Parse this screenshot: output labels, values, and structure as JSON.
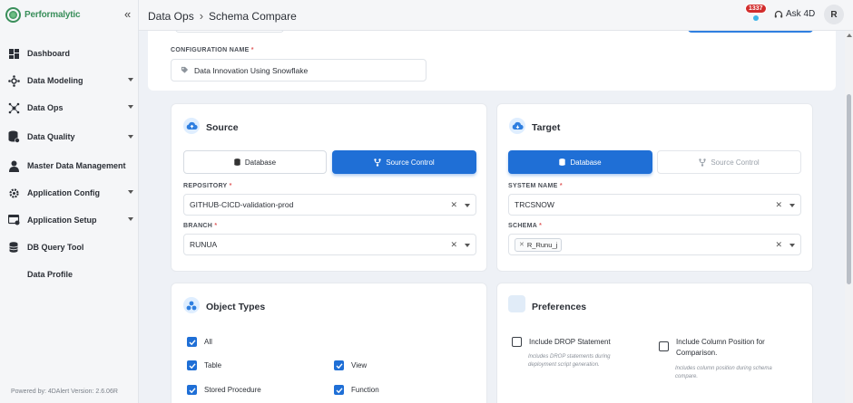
{
  "app": {
    "brand": "Performalytic",
    "collapse_icon": "«"
  },
  "sidebar": {
    "items": [
      {
        "label": "Dashboard",
        "icon": "dashboard-icon",
        "caret": false
      },
      {
        "label": "Data Modeling",
        "icon": "hub-icon",
        "caret": true
      },
      {
        "label": "Data Ops",
        "icon": "network-icon",
        "caret": true
      },
      {
        "label": "Data Quality",
        "icon": "database-check-icon",
        "caret": true
      },
      {
        "label": "Master Data Management",
        "icon": "person-icon",
        "caret": false
      },
      {
        "label": "Application Config",
        "icon": "gear-icon",
        "caret": true
      },
      {
        "label": "Application Setup",
        "icon": "setup-icon",
        "caret": true
      },
      {
        "label": "DB Query Tool",
        "icon": "database-icon",
        "caret": false
      },
      {
        "label": "Data Profile",
        "icon": "",
        "caret": false
      }
    ],
    "footer": "Powered by: 4DAlert   Version: 2.6.06R"
  },
  "header": {
    "crumb_parent": "Data Ops",
    "crumb_sep": "›",
    "crumb_current": "Schema Compare",
    "notification_count": "1337",
    "ask_label": "Ask 4D",
    "avatar_initial": "R"
  },
  "config": {
    "label": "CONFIGURATION NAME",
    "required_mark": "*",
    "value": "Data Innovation Using Snowflake"
  },
  "source": {
    "title": "Source",
    "tab_database": "Database",
    "tab_source_control": "Source Control",
    "repository_label": "REPOSITORY",
    "repository_value": "GITHUB-CICD-validation-prod",
    "branch_label": "BRANCH",
    "branch_value": "RUNUA"
  },
  "target": {
    "title": "Target",
    "tab_database": "Database",
    "tab_source_control": "Source Control",
    "system_label": "SYSTEM NAME",
    "system_value": "TRCSNOW",
    "schema_label": "SCHEMA",
    "schema_chip": "R_Runu_j"
  },
  "object_types": {
    "title": "Object Types",
    "items": [
      {
        "label": "All",
        "checked": true
      },
      {
        "label": "Table",
        "checked": true
      },
      {
        "label": "View",
        "checked": true
      },
      {
        "label": "Stored Procedure",
        "checked": true
      },
      {
        "label": "Function",
        "checked": true
      }
    ]
  },
  "preferences": {
    "title": "Preferences",
    "drop_label": "Include DROP Statement",
    "drop_desc_1": "Includes DROP statements during",
    "drop_desc_2": "deployment script generation.",
    "colpos_label_1": "Include Column Position for",
    "colpos_label_2": "Comparison.",
    "colpos_desc_1": "Includes column position during schema",
    "colpos_desc_2": "compare."
  },
  "colors": {
    "primary": "#1f6fd6",
    "brand": "#3a8f5b",
    "badge": "#d22d2d"
  }
}
